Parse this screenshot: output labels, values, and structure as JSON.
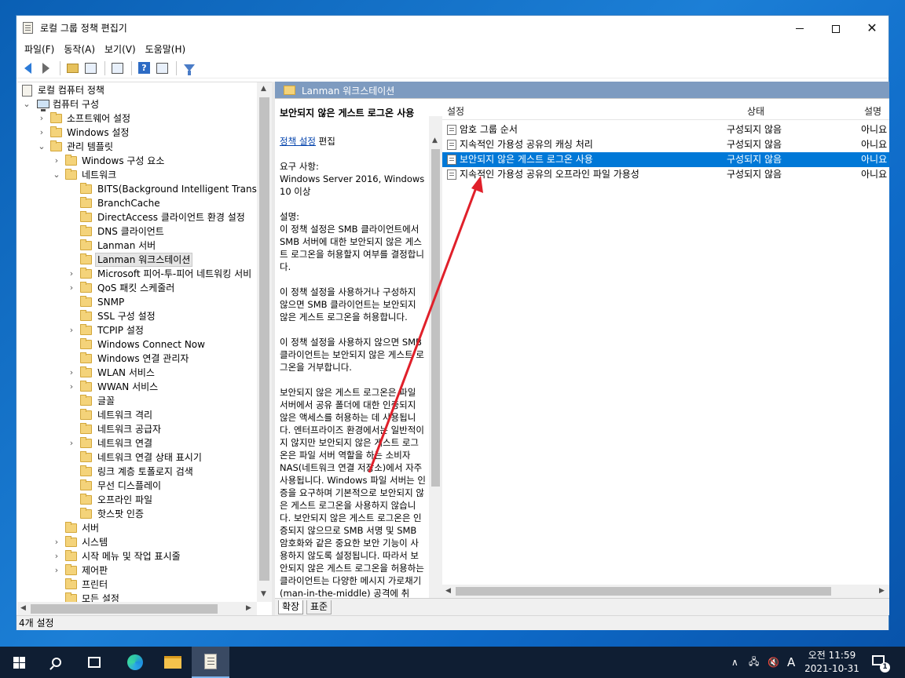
{
  "window": {
    "title": "로컬 그룹 정책 편집기",
    "controls": {
      "minimize": "",
      "maximize": "",
      "close": "✕"
    }
  },
  "menubar": [
    "파일(F)",
    "동작(A)",
    "보기(V)",
    "도움말(H)"
  ],
  "toolbar": {
    "buttons": [
      "back-icon",
      "forward-icon",
      "up-folder-icon",
      "show-hide-tree-icon",
      "export-list-icon",
      "help-icon",
      "properties-icon",
      "filter-icon"
    ]
  },
  "tree": {
    "root": "로컬 컴퓨터 정책",
    "computer_config": "컴퓨터 구성",
    "software_settings": "소프트웨어 설정",
    "windows_settings": "Windows 설정",
    "admin_templates": "관리 템플릿",
    "windows_components": "Windows 구성 요소",
    "network": "네트워크",
    "network_children": [
      "BITS(Background Intelligent Transfer S",
      "BranchCache",
      "DirectAccess 클라이언트 환경 설정",
      "DNS 클라이언트",
      "Lanman 서버",
      "Lanman 워크스테이션",
      "Microsoft 피어-투-피어 네트워킹 서비",
      "QoS 패킷 스케줄러",
      "SNMP",
      "SSL 구성 설정",
      "TCPIP 설정",
      "Windows Connect Now",
      "Windows 연결 관리자",
      "WLAN 서비스",
      "WWAN 서비스",
      "글꼴",
      "네트워크 격리",
      "네트워크 공급자",
      "네트워크 연결",
      "네트워크 연결 상태 표시기",
      "링크 계층 토폴로지 검색",
      "무선 디스플레이",
      "오프라인 파일",
      "핫스팟 인증"
    ],
    "admin_children": [
      "서버",
      "시스템",
      "시작 메뉴 및 작업 표시줄",
      "제어판",
      "프린터",
      "모든 설정"
    ],
    "selected": "Lanman 워크스테이션"
  },
  "right_pane": {
    "header": "Lanman 워크스테이션",
    "description": {
      "title": "보안되지 않은 게스트 로그온 사용",
      "edit_link": "정책 설정",
      "edit_suffix": " 편집",
      "requirements_label": "요구 사항:",
      "requirements": "Windows Server 2016, Windows 10 이상",
      "desc_label": "설명:",
      "p1": "이 정책 설정은 SMB 클라이언트에서 SMB 서버에 대한 보안되지 않은 게스트 로그온을 허용할지 여부를 결정합니다.",
      "p2": "이 정책 설정을 사용하거나 구성하지 않으면 SMB 클라이언트는 보안되지 않은 게스트 로그온을 허용합니다.",
      "p3": "이 정책 설정을 사용하지 않으면 SMB 클라이언트는 보안되지 않은 게스트 로그온을 거부합니다.",
      "p4": "보안되지 않은 게스트 로그온은 파일 서버에서 공유 폴더에 대한 인증되지 않은 액세스를 허용하는 데 사용됩니다. 엔터프라이즈 환경에서는 일반적이지 않지만 보안되지 않은 게스트 로그온은 파일 서버 역할을 하는 소비자 NAS(네트워크 연결 저장소)에서 자주 사용됩니다. Windows 파일 서버는 인증을 요구하며 기본적으로 보안되지 않은 게스트 로그온을 사용하지 않습니다. 보안되지 않은 게스트 로그온은 인증되지 않으므로 SMB 서명 및 SMB 암호화와 같은 중요한 보안 기능이 사용하지 않도록 설정됩니다. 따라서 보안되지 않은 게스트 로그온을 허용하는 클라이언트는 다양한 메시지 가로채기(man-in-the-middle) 공격에 취"
    },
    "columns": [
      "설정",
      "상태",
      "설명"
    ],
    "rows": [
      {
        "name": "암호 그룹 순서",
        "state": "구성되지 않음",
        "comment": "아니요"
      },
      {
        "name": "지속적인 가용성 공유의 캐싱 처리",
        "state": "구성되지 않음",
        "comment": "아니요"
      },
      {
        "name": "보안되지 않은 게스트 로그온 사용",
        "state": "구성되지 않음",
        "comment": "아니요"
      },
      {
        "name": "지속적인 가용성 공유의 오프라인 파일 가용성",
        "state": "구성되지 않음",
        "comment": "아니요"
      }
    ],
    "selected_row": 2,
    "tabs": [
      "확장",
      "표준"
    ]
  },
  "statusbar": "4개 설정",
  "taskbar": {
    "apps": [
      "start-icon",
      "search-icon",
      "task-view-icon",
      "edge-icon",
      "file-explorer-icon",
      "group-policy-editor-icon"
    ],
    "tray": {
      "chevron": "∧",
      "ime": "A",
      "time": "오전 11:59",
      "date": "2021-10-31",
      "notifications": "1"
    }
  },
  "colors": {
    "accent": "#0078d7",
    "pane_header": "#7e9bc0",
    "annotation_arrow": "#e0202a",
    "taskbar": "#0f1e33"
  }
}
